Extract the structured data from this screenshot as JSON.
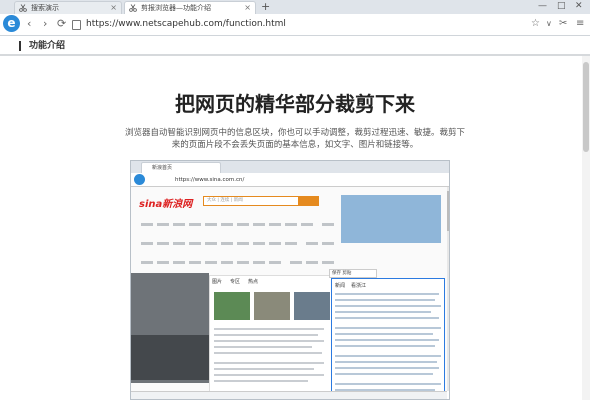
{
  "browser": {
    "tabs": [
      {
        "label": "搜索演示"
      },
      {
        "label": "剪报浏览器—功能介绍"
      }
    ],
    "new_tab": "+",
    "address": "https://www.netscapehub.com/function.html",
    "window_controls": [
      "—",
      "□",
      "✕"
    ]
  },
  "page": {
    "section_title": "功能介绍",
    "headline": "把网页的精华部分裁剪下来",
    "description": "浏览器自动智能识别网页中的信息区块，你也可以手动调整，裁剪过程迅速、敏捷。裁剪下来的页面片段不会丢失页面的基本信息，如文字、图片和链接等。"
  },
  "embedded": {
    "tab_label": "新浪首页",
    "address": "https://www.sina.com.cn/",
    "logo": "sina新浪网",
    "search_placeholder": "大众 | 连续 | 新闻",
    "panel_tabs": [
      "图片",
      "专区",
      "热点"
    ],
    "selection_tabs": [
      "新闻",
      "看浙江"
    ],
    "selection_toolbar": "保存 剪贴"
  },
  "colors": {
    "accent": "#2b8ad8",
    "selection": "#2b7ae0",
    "sina_orange": "#e58a1f"
  }
}
